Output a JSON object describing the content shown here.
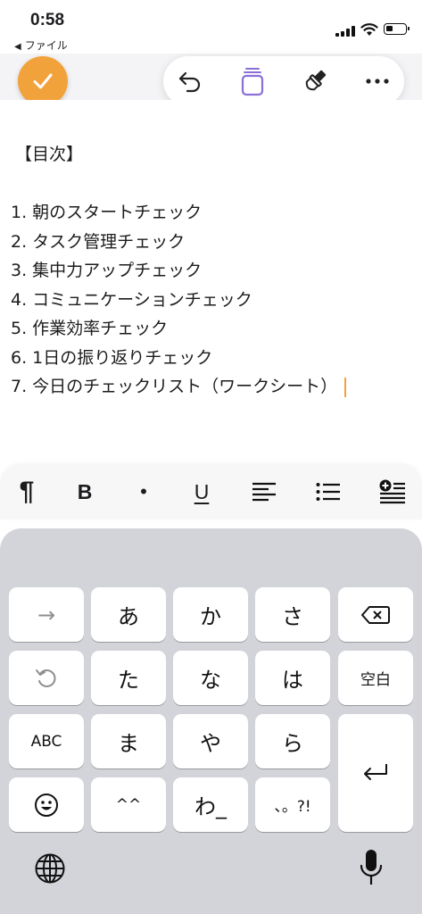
{
  "status": {
    "time": "0:58",
    "back_label": "ファイル"
  },
  "toolbar": {
    "done": "check-icon",
    "undo": "undo-icon",
    "copy": "copy-icon",
    "brush": "brush-icon",
    "more": "more-icon",
    "accent": "#f2a23b",
    "copy_color": "#8b6fd6"
  },
  "document": {
    "heading": "【目次】",
    "items": [
      "1. 朝のスタートチェック",
      "2. タスク管理チェック",
      "3. 集中力アップチェック",
      "4. コミュニケーションチェック",
      "5. 作業効率チェック",
      "6. 1日の振り返りチェック",
      "7. 今日のチェックリスト（ワークシート）"
    ]
  },
  "format_bar": {
    "paragraph": "¶",
    "bold": "B",
    "bullet": "•",
    "underline": "U"
  },
  "keyboard": {
    "arrow": "→",
    "a": "あ",
    "ka": "か",
    "sa": "さ",
    "ta": "た",
    "na": "な",
    "ha": "は",
    "space": "空白",
    "abc": "ABC",
    "ma": "ま",
    "ya": "や",
    "ra": "ら",
    "emoji_face": "^^",
    "wa": "わ_",
    "punct": "、。?!"
  }
}
